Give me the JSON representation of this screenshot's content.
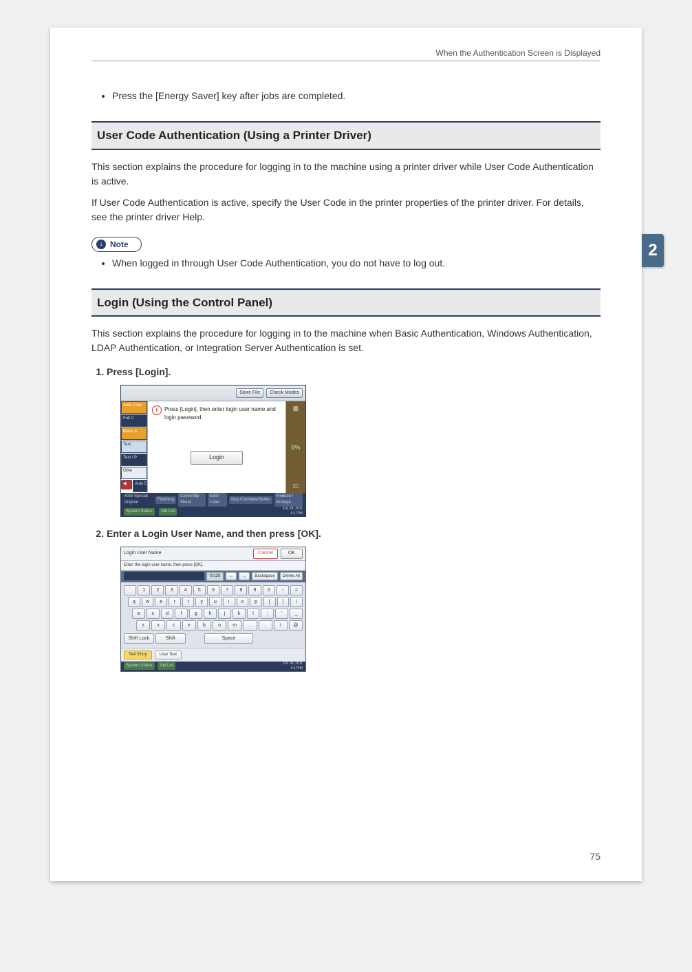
{
  "header": {
    "running_title": "When the Authentication Screen is Displayed"
  },
  "chapter_tab": "2",
  "page_number": "75",
  "intro_bullet": "Press the [Energy Saver] key after jobs are completed.",
  "section1": {
    "title": "User Code Authentication (Using a Printer Driver)",
    "para1": "This section explains the procedure for logging in to the machine using a printer driver while User Code Authentication is active.",
    "para2": "If User Code Authentication is active, specify the User Code in the printer properties of the printer driver. For details, see the printer driver Help.",
    "note_label": "Note",
    "note_bullet": "When logged in through User Code Authentication, you do not have to log out."
  },
  "section2": {
    "title": "Login (Using the Control Panel)",
    "para1": "This section explains the procedure for logging in to the machine when Basic Authentication, Windows Authentication, LDAP Authentication, or Integration Server Authentication is set.",
    "step1": "Press [Login].",
    "step2": "Enter a Login User Name, and then press [OK]."
  },
  "shot1": {
    "store_file": "Store File",
    "check_modes": "Check Modes",
    "sidetabs": [
      "Auto Color",
      "Full C",
      "Black &",
      "Text",
      "Text / P",
      "Othe",
      "Auto De"
    ],
    "msg": "Press [Login], then enter login user name and login password.",
    "login_label": "Login",
    "right_top_icon": "▦",
    "percent": "0%",
    "footer_left": "#030 Special Original",
    "footer_tabs": [
      "Finishing",
      "Cover/Slip Sheet",
      "Edit / Color",
      "Dup./Combine/Series",
      "Reduce / Enlarge"
    ],
    "system_status": "System Status",
    "job_list": "Job List",
    "date": "JUL  28, 2011",
    "time": "6:17PM"
  },
  "shot2": {
    "title": "Login User Name",
    "cancel": "Cancel",
    "ok": "OK",
    "subtitle": "Enter the login user name, then press [OK].",
    "count": "0/128",
    "nav_prev": "←",
    "nav_next": "→",
    "backspace": "Backspace",
    "delete_all": "Delete All",
    "rows": {
      "r1": [
        "`",
        "1",
        "2",
        "3",
        "4",
        "5",
        "6",
        "7",
        "8",
        "9",
        "0",
        "-",
        "="
      ],
      "r2": [
        "q",
        "w",
        "e",
        "r",
        "t",
        "y",
        "u",
        "i",
        "o",
        "p",
        "[",
        "]",
        "\\"
      ],
      "r3": [
        "a",
        "s",
        "d",
        "f",
        "g",
        "h",
        "j",
        "k",
        "l",
        ";",
        "'",
        "_"
      ],
      "r4": [
        "z",
        "x",
        "c",
        "v",
        "b",
        "n",
        "m",
        ",",
        ".",
        "/",
        "@"
      ]
    },
    "shift_lock": "Shift Lock",
    "shift": "Shift",
    "space": "Space",
    "mode_text_entry": "Text Entry",
    "mode_user_text": "User Text",
    "system_status": "System Status",
    "job_list": "Job List",
    "date": "JUL  28, 2011",
    "time": "6:17PM"
  }
}
